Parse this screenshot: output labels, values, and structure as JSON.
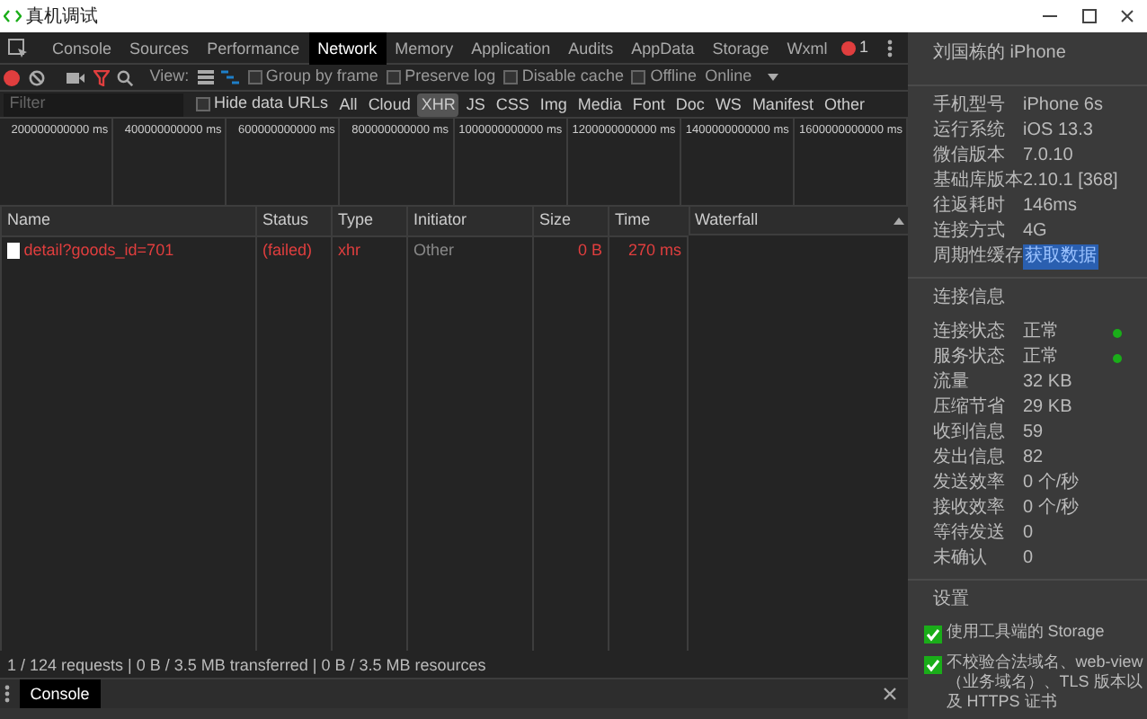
{
  "window": {
    "title": "真机调试"
  },
  "devtools": {
    "tabs": [
      {
        "label": "Console",
        "selected": false
      },
      {
        "label": "Sources",
        "selected": false
      },
      {
        "label": "Performance",
        "selected": false
      },
      {
        "label": "Network",
        "selected": true
      },
      {
        "label": "Memory",
        "selected": false
      },
      {
        "label": "Application",
        "selected": false
      },
      {
        "label": "Audits",
        "selected": false
      },
      {
        "label": "AppData",
        "selected": false
      },
      {
        "label": "Storage",
        "selected": false
      },
      {
        "label": "Wxml",
        "selected": false
      }
    ],
    "error_count": "1"
  },
  "toolbar": {
    "recording": true,
    "filter_on": true,
    "view_label": "View:",
    "options": [
      {
        "label": "Group by frame",
        "checked": false
      },
      {
        "label": "Preserve log",
        "checked": false
      },
      {
        "label": "Disable cache",
        "checked": false
      },
      {
        "label": "Offline",
        "checked": false
      }
    ],
    "throttling": "Online"
  },
  "filter_bar": {
    "placeholder": "Filter",
    "hide_data_urls": {
      "label": "Hide data URLs",
      "checked": false
    },
    "types": [
      {
        "label": "All",
        "selected": false
      },
      {
        "label": "Cloud",
        "selected": false
      },
      {
        "label": "XHR",
        "selected": true
      },
      {
        "label": "JS",
        "selected": false
      },
      {
        "label": "CSS",
        "selected": false
      },
      {
        "label": "Img",
        "selected": false
      },
      {
        "label": "Media",
        "selected": false
      },
      {
        "label": "Font",
        "selected": false
      },
      {
        "label": "Doc",
        "selected": false
      },
      {
        "label": "WS",
        "selected": false
      },
      {
        "label": "Manifest",
        "selected": false
      },
      {
        "label": "Other",
        "selected": false
      }
    ]
  },
  "overview": {
    "ticks": [
      "200000000000 ms",
      "400000000000 ms",
      "600000000000 ms",
      "800000000000 ms",
      "1000000000000 ms",
      "1200000000000 ms",
      "1400000000000 ms",
      "1600000000000 ms"
    ]
  },
  "table": {
    "columns": [
      "Name",
      "Status",
      "Type",
      "Initiator",
      "Size",
      "Time",
      "Waterfall"
    ],
    "rows": [
      {
        "name": "detail?goods_id=701",
        "status": "(failed)",
        "type": "xhr",
        "initiator": "Other",
        "size": "0 B",
        "time": "270 ms",
        "failed": true
      }
    ]
  },
  "status_bar": "1 / 124 requests | 0 B / 3.5 MB transferred | 0 B / 3.5 MB resources",
  "drawer": {
    "tabs": [
      {
        "label": "Console",
        "selected": true
      }
    ]
  },
  "device_panel": {
    "device_name": "刘国栋的 iPhone",
    "info": [
      {
        "label": "手机型号",
        "value": "iPhone 6s",
        "kind": "text"
      },
      {
        "label": "运行系统",
        "value": "iOS 13.3",
        "kind": "text"
      },
      {
        "label": "微信版本",
        "value": "7.0.10",
        "kind": "text"
      },
      {
        "label": "基础库版本",
        "value": "2.10.1 [368]",
        "kind": "text"
      },
      {
        "label": "往返耗时",
        "value": "146ms",
        "kind": "text"
      },
      {
        "label": "连接方式",
        "value": "4G",
        "kind": "text"
      },
      {
        "label": "周期性缓存",
        "value": "获取数据",
        "kind": "link"
      }
    ],
    "connection_title": "连接信息",
    "connection": [
      {
        "label": "连接状态",
        "value": "正常",
        "color": "#1aad19"
      },
      {
        "label": "服务状态",
        "value": "正常",
        "color": "#1aad19"
      },
      {
        "label": "流量",
        "value": "32 KB"
      },
      {
        "label": "压缩节省",
        "value": "29 KB"
      },
      {
        "label": "收到信息",
        "value": "59"
      },
      {
        "label": "发出信息",
        "value": "82"
      },
      {
        "label": "发送效率",
        "value": "0 个/秒"
      },
      {
        "label": "接收效率",
        "value": "0 个/秒"
      },
      {
        "label": "等待发送",
        "value": "0"
      },
      {
        "label": "未确认",
        "value": "0"
      }
    ],
    "settings_title": "设置",
    "settings": [
      {
        "label": "使用工具端的 Storage",
        "checked": true
      },
      {
        "label": "不校验合法域名、web-view（业务域名）、TLS 版本以及 HTTPS 证书",
        "checked": true
      }
    ]
  }
}
